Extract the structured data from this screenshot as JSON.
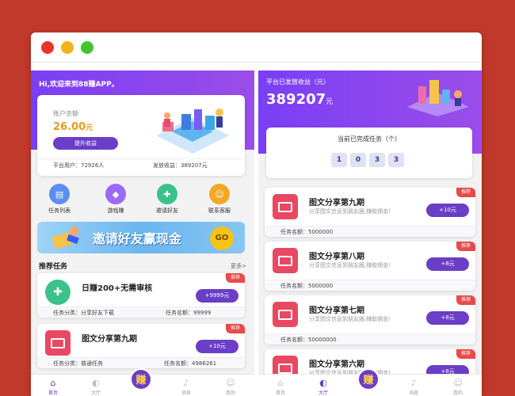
{
  "left": {
    "greeting": "Hi,欢迎来到88赚APP。",
    "balance_label": "账户余额",
    "balance_value": "26.00",
    "balance_unit": "元",
    "upgrade_button": "提升收益",
    "stat_users": "平台用户：72926人",
    "stat_issued": "发放收益：389207元",
    "quick_icons": [
      {
        "label": "任务列表",
        "color": "#5a8ff0",
        "icon": "clipboard-icon"
      },
      {
        "label": "游戏赚",
        "color": "#9b6af5",
        "icon": "gem-icon"
      },
      {
        "label": "邀请好友",
        "color": "#3ac28a",
        "icon": "user-add-icon"
      },
      {
        "label": "联系客服",
        "color": "#f5a623",
        "icon": "smile-icon"
      }
    ],
    "banner_text": "邀请好友赢现金",
    "banner_go": "GO",
    "section_title": "推荐任务",
    "more_link": "更多>",
    "tasks": [
      {
        "title": "日赚200+无需审核",
        "reward": "+9999元",
        "tag": "推荐",
        "cat": "任务分类：分享好友下载",
        "qty": "任务名额：99999",
        "icon": "green"
      },
      {
        "title": "图文分享第九期",
        "reward": "+10元",
        "tag": "推荐",
        "cat": "任务分类：普通任务",
        "qty": "任务名额：4986261",
        "icon": "red"
      }
    ],
    "tabs": [
      {
        "label": "首页",
        "icon": "⌂",
        "active": true
      },
      {
        "label": "大厅",
        "icon": "◐",
        "active": false
      },
      {
        "label": "赚",
        "center": true
      },
      {
        "label": "消息",
        "icon": "♪",
        "active": false
      },
      {
        "label": "我的",
        "icon": "☺",
        "active": false
      }
    ]
  },
  "right": {
    "issued_label": "平台已发放收益（元）",
    "issued_value": "389207",
    "issued_unit": "元",
    "done_title": "当前已完成任务（个）",
    "digits": [
      "1",
      "0",
      "3",
      "3"
    ],
    "tasks": [
      {
        "title": "图文分享第九期",
        "sub": "分享图文信息到朋友圈,赚取佣金!",
        "reward": "+10元",
        "tag": "推荐",
        "qty": "任务名额：5000000"
      },
      {
        "title": "图文分享第八期",
        "sub": "分享图文信息到朋友圈,赚取佣金!",
        "reward": "+8元",
        "tag": "推荐",
        "qty": "任务名额：5000000"
      },
      {
        "title": "图文分享第七期",
        "sub": "分享图文信息到朋友圈,赚取佣金!",
        "reward": "+8元",
        "tag": "推荐",
        "qty": "任务名额：50000000"
      },
      {
        "title": "图文分享第六期",
        "sub": "分享图文信息到朋友圈,赚取佣金!",
        "reward": "+8元",
        "tag": "推荐",
        "qty": ""
      }
    ],
    "tabs": [
      {
        "label": "首页",
        "icon": "⌂",
        "active": false
      },
      {
        "label": "大厅",
        "icon": "◐",
        "active": true
      },
      {
        "label": "赚",
        "center": true
      },
      {
        "label": "消息",
        "icon": "♪",
        "active": false
      },
      {
        "label": "我的",
        "icon": "☺",
        "active": false
      }
    ]
  }
}
